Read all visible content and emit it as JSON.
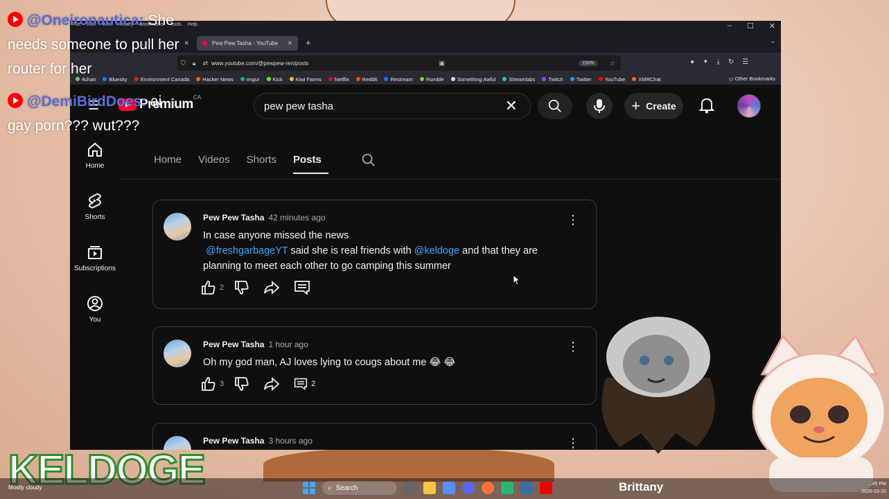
{
  "chat": [
    {
      "user": "@Oneironautica:",
      "message": "She needs someone to pull her router for her"
    },
    {
      "user": "@DemiBirdDoes:",
      "message": "ai gay porn??? wut???"
    }
  ],
  "browser": {
    "menu": [
      "File",
      "Edit",
      "View",
      "History",
      "Bookmarks",
      "Tools",
      "Help"
    ],
    "active_tab_title": "Pew Pew Tasha - YouTube",
    "url": "www.youtube.com/@pewpew-ren/posts",
    "zoom": "150%",
    "bookmarks": [
      {
        "label": "4chan",
        "color": "#7cc576"
      },
      {
        "label": "Bluesky",
        "color": "#1185fe"
      },
      {
        "label": "Environment Canada",
        "color": "#d52b1e"
      },
      {
        "label": "Hacker News",
        "color": "#ff6600"
      },
      {
        "label": "imgur",
        "color": "#1bb76e"
      },
      {
        "label": "Kick",
        "color": "#53fc18"
      },
      {
        "label": "Kiwi Farms",
        "color": "#f6b73c"
      },
      {
        "label": "Netflix",
        "color": "#e50914"
      },
      {
        "label": "Reddit",
        "color": "#ff4500"
      },
      {
        "label": "Restream",
        "color": "#2f6bff"
      },
      {
        "label": "Rumble",
        "color": "#85c742"
      },
      {
        "label": "Something Awful",
        "color": "#d9d9d9"
      },
      {
        "label": "Streamlabs",
        "color": "#31c3a2"
      },
      {
        "label": "Twitch",
        "color": "#9146ff"
      },
      {
        "label": "Twitter",
        "color": "#1d9bf0"
      },
      {
        "label": "YouTube",
        "color": "#ff0000"
      },
      {
        "label": "XMRChat",
        "color": "#f26822"
      }
    ],
    "other_bookmarks": "Other Bookmarks"
  },
  "youtube": {
    "logo_text": "Premium",
    "country": "CA",
    "search_value": "pew pew tasha",
    "create_label": "Create",
    "sidebar": [
      {
        "label": "Home",
        "icon": "home-icon"
      },
      {
        "label": "Shorts",
        "icon": "shorts-icon"
      },
      {
        "label": "Subscriptions",
        "icon": "subscriptions-icon"
      },
      {
        "label": "You",
        "icon": "you-icon"
      }
    ],
    "channel_tabs": [
      "Home",
      "Videos",
      "Shorts",
      "Posts"
    ],
    "active_tab": "Posts",
    "posts": [
      {
        "author": "Pew Pew Tasha",
        "time": "42 minutes ago",
        "line1": "In case anyone missed the news",
        "mention1": "@freshgarbageYT",
        "mid": " said she is real friends with ",
        "mention2": "@keldoge",
        "tail": " and that they are planning to meet each other to go camping this summer",
        "likes": "2",
        "comments": ""
      },
      {
        "author": "Pew Pew Tasha",
        "time": "1 hour ago",
        "text": "Oh my god man, AJ loves lying to cougs about me 😂 😂",
        "likes": "3",
        "comments": "2"
      },
      {
        "author": "Pew Pew Tasha",
        "time": "3 hours ago"
      }
    ]
  },
  "overlay": {
    "logo": "KELDOGE",
    "vtuber_name": "Brittany"
  },
  "taskbar": {
    "weather": "Mostly cloudy",
    "search": "Search",
    "date": "2026-03-20",
    "time": "...45 PM"
  }
}
